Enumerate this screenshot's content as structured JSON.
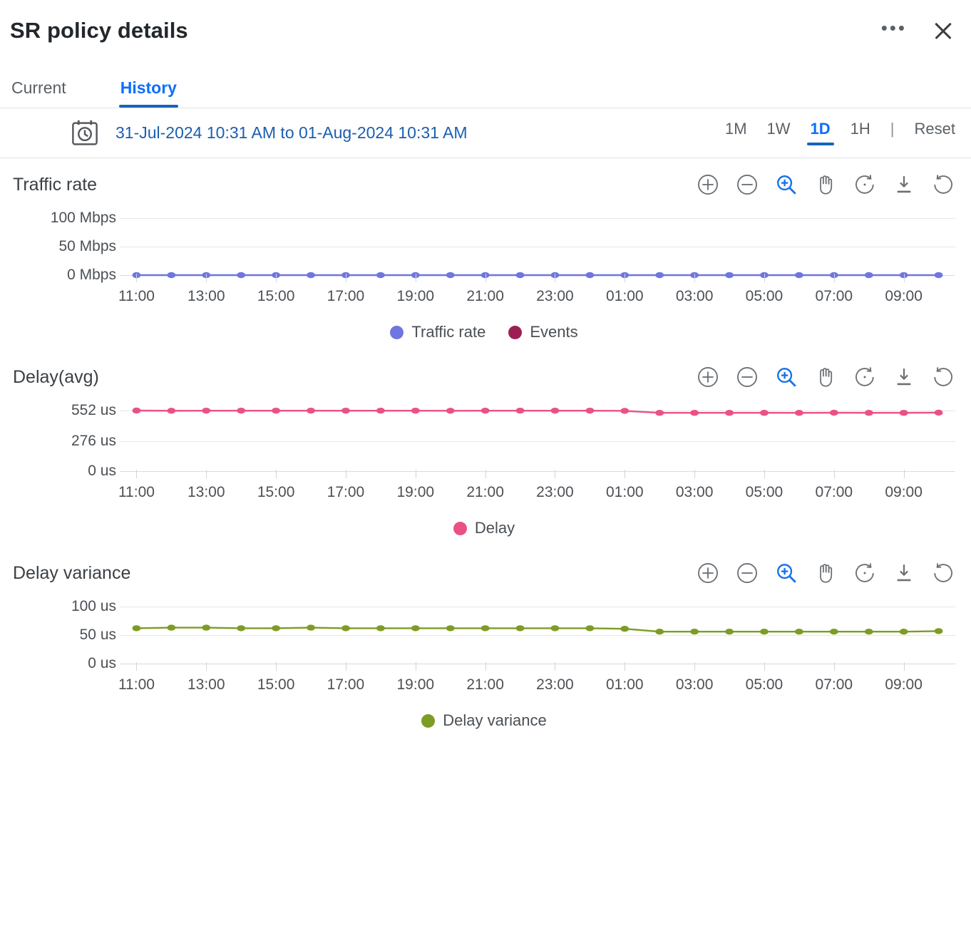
{
  "header": {
    "title": "SR policy details",
    "more_label": "•••",
    "close_label": ""
  },
  "tabs": [
    {
      "label": "Current",
      "active": false
    },
    {
      "label": "History",
      "active": true
    }
  ],
  "range_row": {
    "calendar_icon": "calendar-clock-icon",
    "date_range": "31-Jul-2024 10:31 AM to 01-Aug-2024 10:31 AM",
    "buttons": [
      {
        "label": "1M",
        "active": false
      },
      {
        "label": "1W",
        "active": false
      },
      {
        "label": "1D",
        "active": true
      },
      {
        "label": "1H",
        "active": false
      }
    ],
    "separator": "|",
    "reset_label": "Reset"
  },
  "toolbar_icons": [
    "zoom-in-icon",
    "zoom-out-icon",
    "selection-zoom-icon",
    "panning-icon",
    "reset-zoom-icon",
    "download-icon",
    "refresh-icon"
  ],
  "colors": {
    "accent": "#0d6efd",
    "traffic_rate": "#6f76e0",
    "events": "#9c1f54",
    "delay": "#ea5184",
    "delay_variance": "#7d9c24",
    "grid": "#e6e7e9"
  },
  "chart_data": [
    {
      "type": "line",
      "title": "Traffic rate",
      "xlabel": "",
      "ylabel": "",
      "ylim": [
        0,
        100
      ],
      "yticks": [
        0,
        50,
        100
      ],
      "ytick_labels": [
        "0 Mbps",
        "50 Mbps",
        "100 Mbps"
      ],
      "grid": true,
      "legend_position": "bottom",
      "x": [
        "11:00",
        "12:00",
        "13:00",
        "14:00",
        "15:00",
        "16:00",
        "17:00",
        "18:00",
        "19:00",
        "20:00",
        "21:00",
        "22:00",
        "23:00",
        "00:00",
        "01:00",
        "02:00",
        "03:00",
        "04:00",
        "05:00",
        "06:00",
        "07:00",
        "08:00",
        "09:00",
        "10:00"
      ],
      "xtick_labels": [
        "11:00",
        "13:00",
        "15:00",
        "17:00",
        "19:00",
        "21:00",
        "23:00",
        "01:00",
        "03:00",
        "05:00",
        "07:00",
        "09:00"
      ],
      "series": [
        {
          "name": "Traffic rate",
          "color": "#6f76e0",
          "values": [
            0,
            0,
            0,
            0,
            0,
            0,
            0,
            0,
            0,
            0,
            0,
            0,
            0,
            0,
            0,
            0,
            0,
            0,
            0,
            0,
            0,
            0,
            0,
            0
          ]
        },
        {
          "name": "Events",
          "color": "#9c1f54",
          "values": []
        }
      ]
    },
    {
      "type": "line",
      "title": "Delay(avg)",
      "xlabel": "",
      "ylabel": "",
      "ylim": [
        0,
        552
      ],
      "yticks": [
        0,
        276,
        552
      ],
      "ytick_labels": [
        "0 us",
        "276 us",
        "552 us"
      ],
      "grid": true,
      "legend_position": "bottom",
      "x": [
        "11:00",
        "12:00",
        "13:00",
        "14:00",
        "15:00",
        "16:00",
        "17:00",
        "18:00",
        "19:00",
        "20:00",
        "21:00",
        "22:00",
        "23:00",
        "00:00",
        "01:00",
        "02:00",
        "03:00",
        "04:00",
        "05:00",
        "06:00",
        "07:00",
        "08:00",
        "09:00",
        "10:00"
      ],
      "xtick_labels": [
        "11:00",
        "13:00",
        "15:00",
        "17:00",
        "19:00",
        "21:00",
        "23:00",
        "01:00",
        "03:00",
        "05:00",
        "07:00",
        "09:00"
      ],
      "series": [
        {
          "name": "Delay",
          "color": "#ea5184",
          "values": [
            552,
            550,
            551,
            551,
            551,
            551,
            551,
            551,
            551,
            550,
            551,
            551,
            551,
            551,
            549,
            531,
            531,
            531,
            531,
            531,
            532,
            531,
            531,
            533
          ]
        }
      ]
    },
    {
      "type": "line",
      "title": "Delay variance",
      "xlabel": "",
      "ylabel": "",
      "ylim": [
        0,
        100
      ],
      "yticks": [
        0,
        50,
        100
      ],
      "ytick_labels": [
        "0 us",
        "50 us",
        "100 us"
      ],
      "grid": true,
      "legend_position": "bottom",
      "x": [
        "11:00",
        "12:00",
        "13:00",
        "14:00",
        "15:00",
        "16:00",
        "17:00",
        "18:00",
        "19:00",
        "20:00",
        "21:00",
        "22:00",
        "23:00",
        "00:00",
        "01:00",
        "02:00",
        "03:00",
        "04:00",
        "05:00",
        "06:00",
        "07:00",
        "08:00",
        "09:00",
        "10:00"
      ],
      "xtick_labels": [
        "11:00",
        "13:00",
        "15:00",
        "17:00",
        "19:00",
        "21:00",
        "23:00",
        "01:00",
        "03:00",
        "05:00",
        "07:00",
        "09:00"
      ],
      "series": [
        {
          "name": "Delay variance",
          "color": "#7d9c24",
          "values": [
            62,
            63,
            63,
            62,
            62,
            63,
            62,
            62,
            62,
            62,
            62,
            62,
            62,
            62,
            61,
            56,
            56,
            56,
            56,
            56,
            56,
            56,
            56,
            57
          ]
        }
      ]
    }
  ]
}
